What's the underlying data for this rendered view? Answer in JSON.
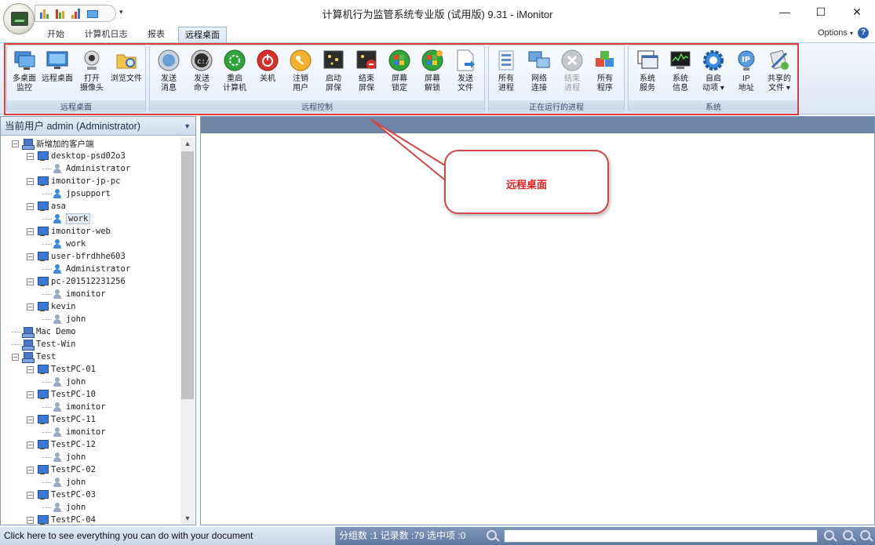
{
  "window": {
    "title": "计算机行为监管系统专业版 (试用版) 9.31 - iMonitor",
    "controls": {
      "minimize": "—",
      "maximize": "☐",
      "close": "✕"
    }
  },
  "tabs": [
    {
      "label": "开始"
    },
    {
      "label": "计算机日志"
    },
    {
      "label": "报表"
    },
    {
      "label": "远程桌面",
      "active": true
    }
  ],
  "options_label": "Options",
  "help_label": "?",
  "ribbon": {
    "groups": [
      {
        "label": "远程桌面",
        "buttons": [
          {
            "line1": "多桌面",
            "line2": "监控",
            "icon": "multi-desktop-icon"
          },
          {
            "line1": "远程桌面",
            "line2": "",
            "icon": "remote-desktop-icon"
          },
          {
            "line1": "打开",
            "line2": "摄像头",
            "icon": "webcam-icon"
          },
          {
            "line1": "浏览文件",
            "line2": "",
            "icon": "folder-search-icon"
          }
        ]
      },
      {
        "label": "远程控制",
        "buttons": [
          {
            "line1": "发送",
            "line2": "消息",
            "icon": "message-icon"
          },
          {
            "line1": "发送",
            "line2": "命令",
            "icon": "command-icon"
          },
          {
            "line1": "重启",
            "line2": "计算机",
            "icon": "restart-icon"
          },
          {
            "line1": "关机",
            "line2": "",
            "icon": "shutdown-icon"
          },
          {
            "line1": "注销",
            "line2": "用户",
            "icon": "logoff-key-icon"
          },
          {
            "line1": "启动",
            "line2": "屏保",
            "icon": "start-screensaver-icon"
          },
          {
            "line1": "结束",
            "line2": "屏保",
            "icon": "stop-screensaver-icon"
          },
          {
            "line1": "屏幕",
            "line2": "锁定",
            "icon": "screen-lock-icon"
          },
          {
            "line1": "屏幕",
            "line2": "解锁",
            "icon": "screen-unlock-icon"
          },
          {
            "line1": "发送",
            "line2": "文件",
            "icon": "send-file-icon"
          }
        ]
      },
      {
        "label": "正在运行的进程",
        "buttons": [
          {
            "line1": "所有",
            "line2": "进程",
            "icon": "processes-icon"
          },
          {
            "line1": "网络",
            "line2": "连接",
            "icon": "network-icon"
          },
          {
            "line1": "结束",
            "line2": "进程",
            "icon": "end-process-icon",
            "disabled": true
          },
          {
            "line1": "所有",
            "line2": "程序",
            "icon": "programs-icon"
          }
        ]
      },
      {
        "label": "系统",
        "buttons": [
          {
            "line1": "系统",
            "line2": "服务",
            "icon": "services-icon"
          },
          {
            "line1": "系统",
            "line2": "信息",
            "icon": "system-info-icon"
          },
          {
            "line1": "自启",
            "line2": "动项 ▾",
            "icon": "autostart-gear-icon"
          },
          {
            "line1": "IP",
            "line2": "地址",
            "icon": "ip-address-icon"
          },
          {
            "line1": "共享的",
            "line2": "文件 ▾",
            "icon": "shared-files-icon"
          }
        ]
      }
    ]
  },
  "left_panel": {
    "header": "当前用户 admin (Administrator)",
    "tree": [
      {
        "level": 0,
        "type": "group",
        "label": "新增加的客户端",
        "exp": "−"
      },
      {
        "level": 1,
        "type": "pc",
        "label": "desktop-psd02o3",
        "exp": "−"
      },
      {
        "level": 2,
        "type": "user",
        "label": "Administrator"
      },
      {
        "level": 1,
        "type": "pc",
        "label": "imonitor-jp-pc",
        "exp": "−"
      },
      {
        "level": 2,
        "type": "user-blue",
        "label": "jpsupport"
      },
      {
        "level": 1,
        "type": "pc",
        "label": "asa",
        "exp": "−"
      },
      {
        "level": 2,
        "type": "user-blue",
        "label": "work",
        "selected": true
      },
      {
        "level": 1,
        "type": "pc",
        "label": "imonitor-web",
        "exp": "−"
      },
      {
        "level": 2,
        "type": "user-blue",
        "label": "work"
      },
      {
        "level": 1,
        "type": "pc",
        "label": "user-bfrdhhe603",
        "exp": "−"
      },
      {
        "level": 2,
        "type": "user-blue",
        "label": "Administrator"
      },
      {
        "level": 1,
        "type": "pc",
        "label": "pc-201512231256",
        "exp": "−"
      },
      {
        "level": 2,
        "type": "user",
        "label": "imonitor"
      },
      {
        "level": 1,
        "type": "pc",
        "label": "kevin",
        "exp": "−"
      },
      {
        "level": 2,
        "type": "user",
        "label": "john"
      },
      {
        "level": 0,
        "type": "group",
        "label": "Mac Demo"
      },
      {
        "level": 0,
        "type": "group",
        "label": "Test-Win"
      },
      {
        "level": 0,
        "type": "group",
        "label": "Test",
        "exp": "−"
      },
      {
        "level": 1,
        "type": "pc",
        "label": "TestPC-01",
        "exp": "−"
      },
      {
        "level": 2,
        "type": "user",
        "label": "john"
      },
      {
        "level": 1,
        "type": "pc",
        "label": "TestPC-10",
        "exp": "−"
      },
      {
        "level": 2,
        "type": "user",
        "label": "imonitor"
      },
      {
        "level": 1,
        "type": "pc",
        "label": "TestPC-11",
        "exp": "−"
      },
      {
        "level": 2,
        "type": "user",
        "label": "imonitor"
      },
      {
        "level": 1,
        "type": "pc",
        "label": "TestPC-12",
        "exp": "−"
      },
      {
        "level": 2,
        "type": "user",
        "label": "john"
      },
      {
        "level": 1,
        "type": "pc",
        "label": "TestPC-02",
        "exp": "−"
      },
      {
        "level": 2,
        "type": "user",
        "label": "john"
      },
      {
        "level": 1,
        "type": "pc",
        "label": "TestPC-03",
        "exp": "−"
      },
      {
        "level": 2,
        "type": "user",
        "label": "john"
      },
      {
        "level": 1,
        "type": "pc",
        "label": "TestPC-04",
        "exp": "−"
      }
    ]
  },
  "callout": {
    "text": "远程桌面"
  },
  "status_bar": {
    "hint": "Click here to see everything you can do with your document",
    "stats": "分组数 :1  记录数 :79  选中项 :0"
  },
  "colors": {
    "highlight_border": "#e23b3b",
    "callout_text": "#e02020",
    "status_bg": "#6e85a8"
  }
}
